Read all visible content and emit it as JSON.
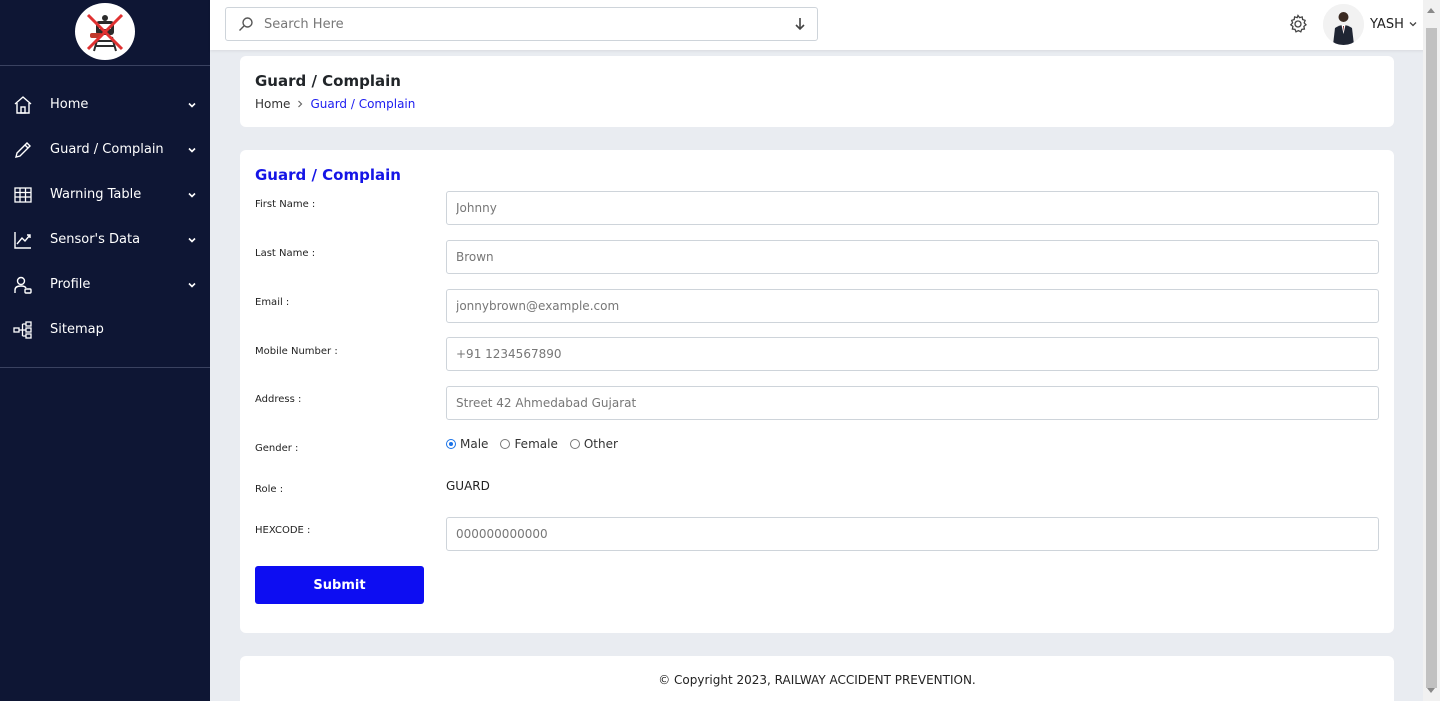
{
  "sidebar": {
    "logo_icon": "railway-crossing-logo-icon",
    "items": [
      {
        "label": "Home",
        "icon": "home-icon",
        "has_submenu": true
      },
      {
        "label": "Guard / Complain",
        "icon": "pencil-icon",
        "has_submenu": true
      },
      {
        "label": "Warning Table",
        "icon": "table-icon",
        "has_submenu": true
      },
      {
        "label": "Sensor's Data",
        "icon": "chart-line-icon",
        "has_submenu": true
      },
      {
        "label": "Profile",
        "icon": "user-icon",
        "has_submenu": true
      },
      {
        "label": "Sitemap",
        "icon": "sitemap-icon",
        "has_submenu": false
      }
    ]
  },
  "topbar": {
    "search_placeholder": "Search Here",
    "user_name": "YASH"
  },
  "header": {
    "page_title": "Guard / Complain",
    "breadcrumb": {
      "home": "Home",
      "current": "Guard / Complain"
    }
  },
  "form": {
    "title": "Guard / Complain",
    "fields": {
      "first_name": {
        "label": "First Name :",
        "placeholder": "Johnny"
      },
      "last_name": {
        "label": "Last Name :",
        "placeholder": "Brown"
      },
      "email": {
        "label": "Email :",
        "placeholder": "jonnybrown@example.com"
      },
      "mobile": {
        "label": "Mobile Number :",
        "placeholder": "+91 1234567890"
      },
      "address": {
        "label": "Address :",
        "placeholder": "Street 42 Ahmedabad Gujarat"
      },
      "hexcode": {
        "label": "HEXCODE :",
        "placeholder": "000000000000"
      }
    },
    "gender": {
      "label": "Gender :",
      "options": [
        "Male",
        "Female",
        "Other"
      ],
      "selected": "Male"
    },
    "role": {
      "label": "Role :",
      "value": "GUARD"
    },
    "submit_label": "Submit"
  },
  "footer": {
    "copyright": "© Copyright 2023, RAILWAY ACCIDENT PREVENTION."
  },
  "colors": {
    "sidebar_bg": "#0e1634",
    "accent": "#0d0df2",
    "page_bg": "#e9ecf1"
  }
}
